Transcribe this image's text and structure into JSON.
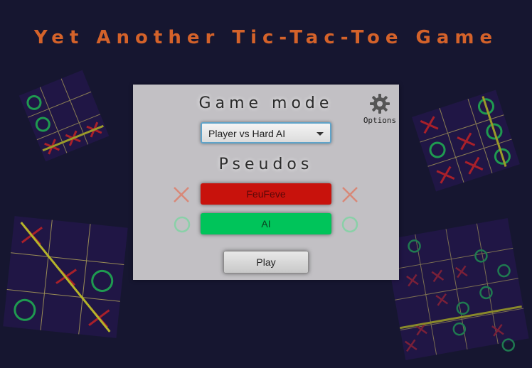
{
  "app_title": "Yet Another Tic-Tac-Toe Game",
  "panel": {
    "game_mode_heading": "Game mode",
    "options_label": "Options",
    "options_icon": "gear-icon",
    "mode_select_value": "Player vs Hard AI",
    "pseudos_heading": "Pseudos",
    "player_x_name": "FeuFeve",
    "player_o_name": "AI",
    "play_label": "Play"
  },
  "colors": {
    "title": "#d4622a",
    "background": "#161630",
    "panel": "#c2c0c4",
    "player_x_field": "#c8120c",
    "player_o_field": "#00c45a",
    "x_symbol": "#d88878",
    "o_symbol": "#8ad0a8"
  }
}
